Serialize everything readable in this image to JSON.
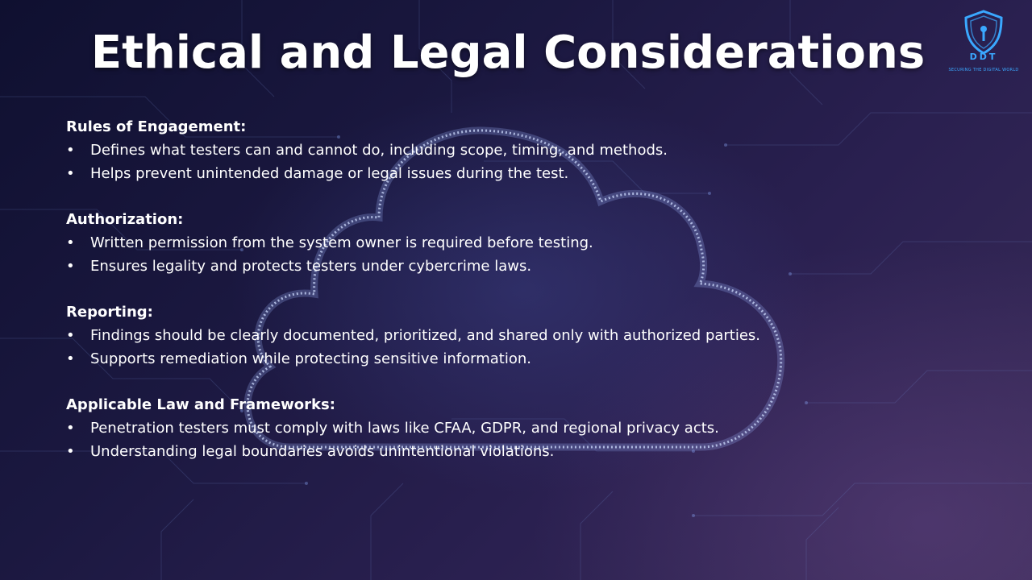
{
  "slide": {
    "title": "Ethical and Legal Considerations",
    "logo": {
      "icon": "shield-keyhole-icon",
      "text": "DDT",
      "tagline": "SECURING THE DIGITAL WORLD",
      "color": "#3aa8ff"
    },
    "bullet_glyph": "•",
    "sections": [
      {
        "heading": "Rules of Engagement:",
        "bullets": [
          "Defines what testers can and cannot do, including scope, timing, and methods.",
          "Helps prevent unintended damage or legal issues during the test."
        ]
      },
      {
        "heading": "Authorization:",
        "bullets": [
          "Written permission from the system owner is required before testing.",
          "Ensures legality and protects testers under cybercrime laws."
        ]
      },
      {
        "heading": "Reporting:",
        "bullets": [
          "Findings should be clearly documented, prioritized, and shared only with authorized parties.",
          "Supports remediation while protecting sensitive information."
        ]
      },
      {
        "heading": "Applicable Law and Frameworks:",
        "bullets": [
          "Penetration testers must comply with laws like CFAA, GDPR, and regional privacy acts.",
          "Understanding legal boundaries avoids unintentional violations."
        ]
      }
    ],
    "colors": {
      "text": "#ffffff",
      "accent": "#3aa8ff",
      "background": "#1b1840"
    }
  }
}
